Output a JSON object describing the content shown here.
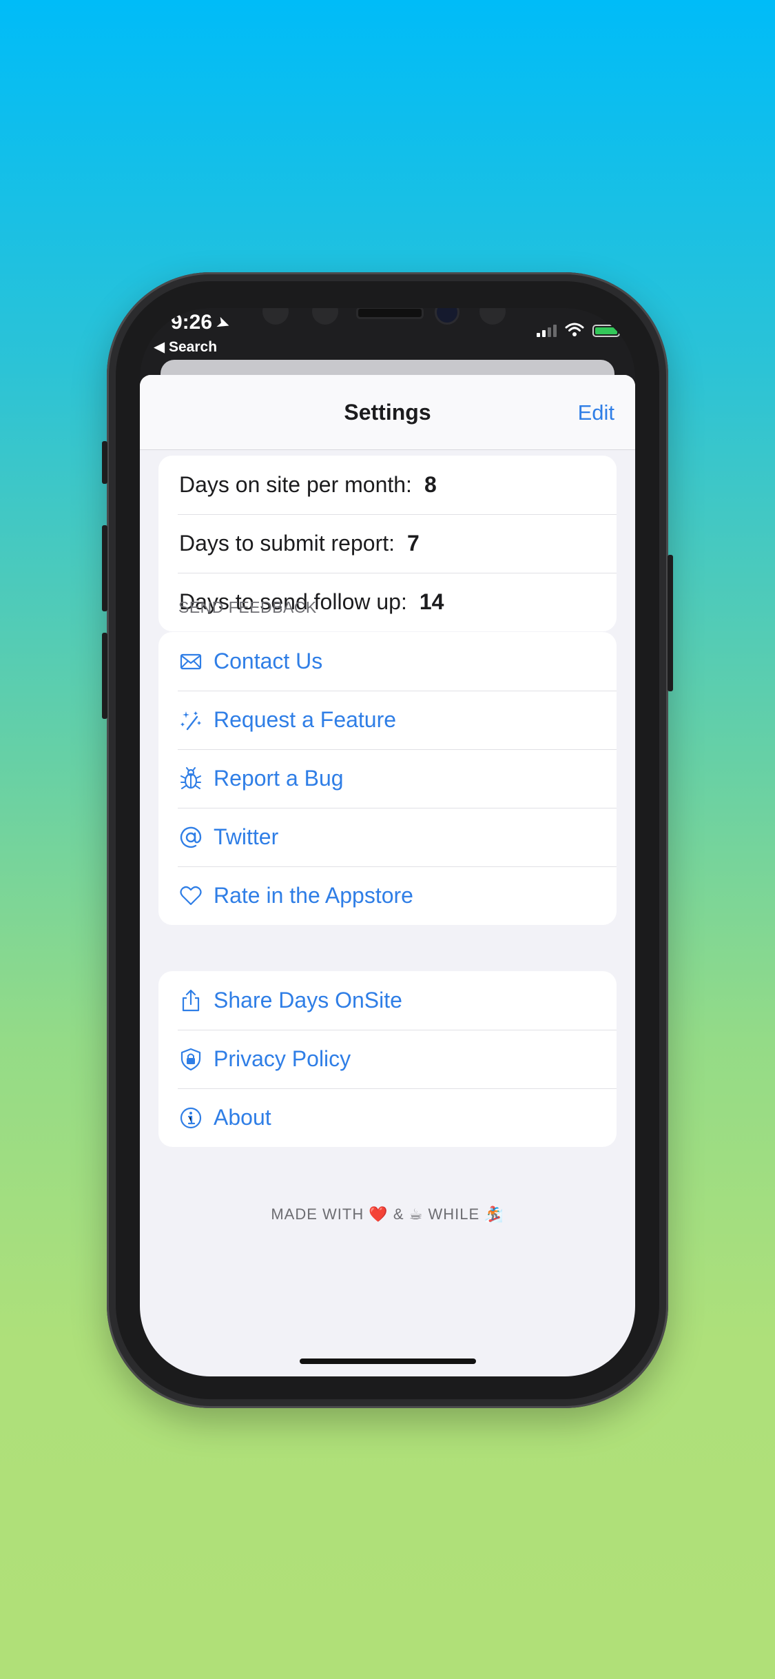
{
  "status_bar": {
    "time": "9:26",
    "back_label": "◀ Search"
  },
  "nav": {
    "title": "Settings",
    "edit_label": "Edit"
  },
  "stats": [
    {
      "label": "Days on site per month:",
      "value": "8"
    },
    {
      "label": "Days to submit report:",
      "value": "7"
    },
    {
      "label": "Days to send follow up:",
      "value": "14"
    }
  ],
  "feedback_header": "SEND FEEDBACK",
  "feedback_items": [
    {
      "label": "Contact Us",
      "icon": "envelope-icon"
    },
    {
      "label": "Request a Feature",
      "icon": "sparkles-icon"
    },
    {
      "label": "Report a Bug",
      "icon": "ladybug-icon"
    },
    {
      "label": "Twitter",
      "icon": "at-sign-icon"
    },
    {
      "label": "Rate in the Appstore",
      "icon": "heart-icon"
    }
  ],
  "other_items": [
    {
      "label": "Share Days OnSite",
      "icon": "share-icon"
    },
    {
      "label": "Privacy Policy",
      "icon": "lock-shield-icon"
    },
    {
      "label": "About",
      "icon": "info-icon"
    }
  ],
  "footer": "MADE WITH ❤️ & ☕ WHILE 🏂",
  "colors": {
    "accent": "#2f7ee6",
    "background_top": "#00bcf8",
    "background_bottom": "#b0e078"
  }
}
